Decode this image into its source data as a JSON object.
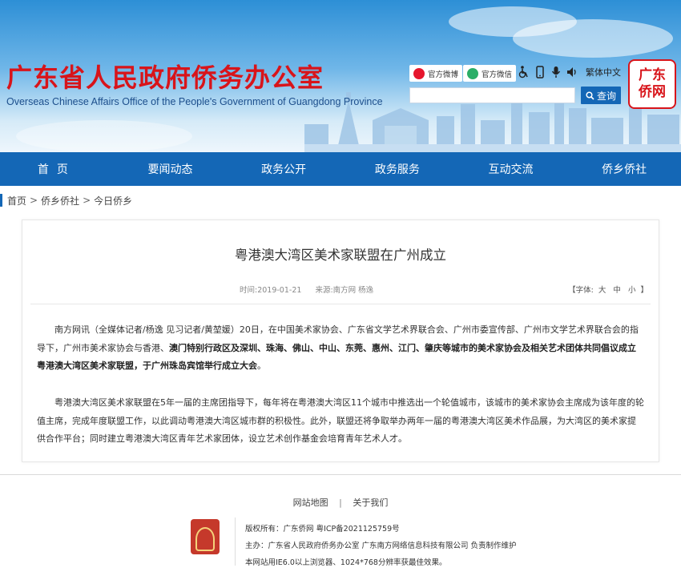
{
  "header": {
    "title": "广东省人民政府侨务办公室",
    "subtitle": "Overseas Chinese Affairs Office of the People's Government of Guangdong Province",
    "weibo": "官方微博",
    "wechat": "官方微信",
    "traditional": "繁体中文",
    "search_placeholder": "",
    "search_button": "查询",
    "logo_line1": "广东",
    "logo_line2": "侨网"
  },
  "nav": {
    "items": [
      "首页",
      "要闻动态",
      "政务公开",
      "政务服务",
      "互动交流",
      "侨乡侨社"
    ]
  },
  "breadcrumb": {
    "items": [
      "首页",
      "侨乡侨社",
      "今日侨乡"
    ],
    "separator": ">"
  },
  "article": {
    "title": "粤港澳大湾区美术家联盟在广州成立",
    "date": "时间:2019-01-21",
    "source": "来源:南方网 杨逸",
    "font_label_open": "【字体:",
    "font_large": "大",
    "font_medium": "中",
    "font_small": "小",
    "font_label_close": "】",
    "p1_a": "南方网讯（全媒体记者/杨逸 见习记者/黄堃媛）20日，在中国美术家协会、广东省文学艺术界联合会、广州市委宣传部、广州市文学艺术界联合会的指导下，广州市美术家协会与香港、",
    "p1_b": "澳门特别行政区及深圳、珠海、佛山、中山、东莞、惠州、江门、肇庆等城市的美术家协会及相关艺术团体共同倡议成立粤港澳大湾区美术家联盟，于广州珠岛宾馆举行成立大会",
    "p1_c": "。",
    "p2": "粤港澳大湾区美术家联盟在5年一届的主席团指导下，每年将在粤港澳大湾区11个城市中推选出一个轮值城市，该城市的美术家协会主席成为该年度的轮值主席，完成年度联盟工作，以此调动粤港澳大湾区城市群的积极性。此外，联盟还将争取举办两年一届的粤港澳大湾区美术作品展，为大湾区的美术家提供合作平台；同时建立粤港澳大湾区青年艺术家团体，设立艺术创作基金会培育青年艺术人才。"
  },
  "footer": {
    "sitemap": "网站地图",
    "separator": "|",
    "about": "关于我们",
    "copyright": "版权所有：广东侨网    粤ICP备2021125759号",
    "host": "主办：广东省人民政府侨务办公室 广东南方网络信息科技有限公司 负责制作维护",
    "browser": "本网站用IE6.0以上浏览器、1024*768分辨率获最佳效果。",
    "badge_icon": "party-government-badge-icon"
  },
  "colors": {
    "brand_red": "#d8141a",
    "nav_blue": "#1467b6"
  }
}
